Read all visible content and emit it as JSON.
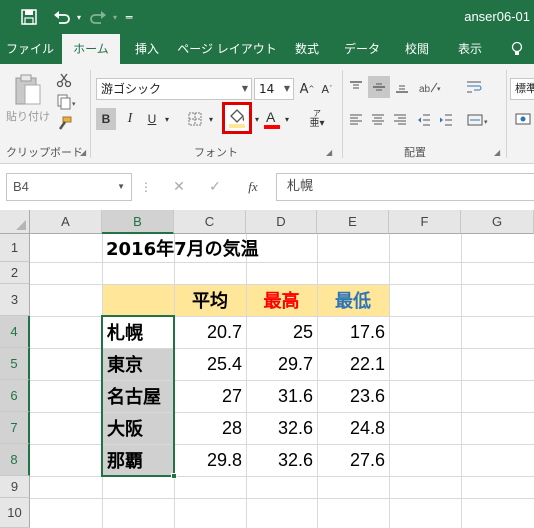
{
  "titlebar": {
    "doc_name": "anser06-01"
  },
  "tabs": [
    "ファイル",
    "ホーム",
    "挿入",
    "ページ レイアウト",
    "数式",
    "データ",
    "校閲",
    "表示"
  ],
  "ribbon": {
    "paste_label": "貼り付け",
    "font_name": "游ゴシック",
    "font_size": "14",
    "number_format": "標準",
    "groups": {
      "clipboard": "クリップボード",
      "font": "フォント",
      "alignment": "配置"
    }
  },
  "formula_bar": {
    "name_box": "B4",
    "fx": "fx",
    "content": "札幌"
  },
  "columns": [
    "A",
    "B",
    "C",
    "D",
    "E",
    "F",
    "G"
  ],
  "rows": [
    "1",
    "2",
    "3",
    "4",
    "5",
    "6",
    "7",
    "8",
    "9",
    "10"
  ],
  "sheet": {
    "title": "2016年7月の気温",
    "headers": {
      "avg": "平均",
      "max": "最高",
      "min": "最低"
    },
    "cities": [
      "札幌",
      "東京",
      "名古屋",
      "大阪",
      "那覇"
    ],
    "avg": [
      "20.7",
      "25.4",
      "27",
      "28",
      "29.8"
    ],
    "max": [
      "25",
      "29.7",
      "31.6",
      "32.6",
      "32.6"
    ],
    "min": [
      "17.6",
      "22.1",
      "23.6",
      "24.8",
      "27.6"
    ]
  },
  "colors": {
    "excel_green": "#217346",
    "header_fill": "#ffe699",
    "selection_fill": "#d0d0d0",
    "max_color": "#ff0000",
    "min_color": "#2e75b6",
    "highlight_border": "#e00000"
  }
}
